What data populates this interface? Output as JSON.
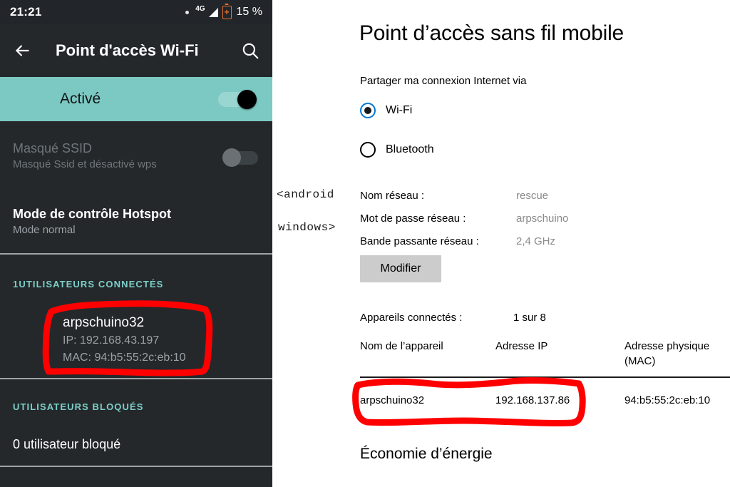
{
  "colors": {
    "teal_banner": "#7cc9c3",
    "teal_heading": "#7ccfc8",
    "phone_background": "#24282b",
    "annotation_red": "#fe0000",
    "windows_accent": "#0078d7",
    "button_gray": "#cccccc",
    "battery_orange": "#e8702a"
  },
  "phone": {
    "statusbar": {
      "clock": "21:21",
      "network_type": "4G",
      "battery_percent": "15 %"
    },
    "appbar": {
      "title": "Point d'accès Wi-Fi"
    },
    "enabled_row": {
      "label": "Activé"
    },
    "rows": [
      {
        "title": "Masqué SSID",
        "subtitle": "Masqué Ssid et désactivé wps"
      },
      {
        "title": "Mode de contrôle Hotspot",
        "subtitle": "Mode normal"
      }
    ],
    "connected_section": {
      "heading": "1UTILISATEURS CONNECTÉS",
      "device": {
        "name": "arpschuino32",
        "ip": "IP: 192.168.43.197",
        "mac": "MAC: 94:b5:55:2c:eb:10"
      }
    },
    "blocked_section": {
      "heading": "UTILISATEURS BLOQUÉS",
      "text": "0 utilisateur bloqué"
    }
  },
  "windows": {
    "title": "Point d’accès sans fil mobile",
    "share_label": "Partager ma connexion Internet via",
    "radios": [
      {
        "label": "Wi-Fi",
        "checked": true
      },
      {
        "label": "Bluetooth",
        "checked": false
      }
    ],
    "annotation": {
      "line1": "<android",
      "line2": "windows>"
    },
    "network_info": [
      {
        "label": "Nom réseau :",
        "value": "rescue"
      },
      {
        "label": "Mot de passe réseau :",
        "value": "arpschuino"
      },
      {
        "label": "Bande passante réseau :",
        "value": "2,4 GHz"
      }
    ],
    "edit_button": "Modifier",
    "connected_devices": {
      "label": "Appareils connectés :",
      "value": "1 sur 8"
    },
    "table": {
      "headers": [
        "Nom de l’appareil",
        "Adresse IP",
        "Adresse physique (MAC)"
      ],
      "header_mac_line1": "Adresse physique",
      "header_mac_line2": "(MAC)",
      "rows": [
        {
          "device_name": "arpschuino32",
          "ip": "192.168.137.86",
          "mac": "94:b5:55:2c:eb:10"
        }
      ]
    },
    "power_section_title": "Économie d’énergie"
  }
}
